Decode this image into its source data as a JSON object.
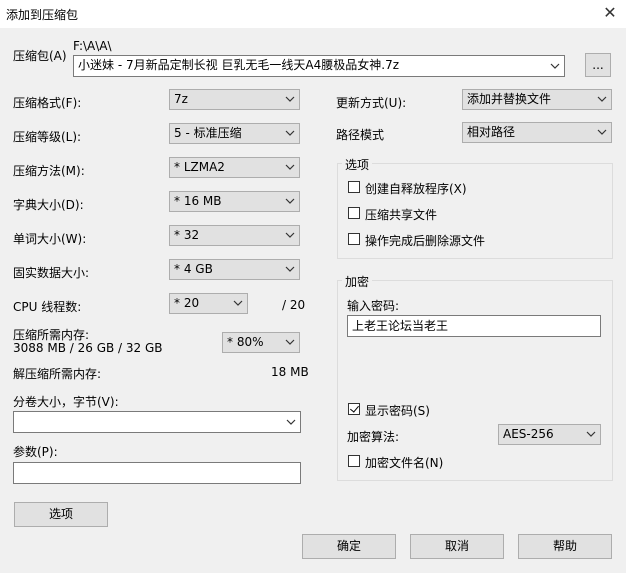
{
  "window": {
    "title": "添加到压缩包",
    "close_glyph": "✕"
  },
  "archive": {
    "label": "压缩包(A)",
    "path": "F:\\A\\A\\",
    "filename": "小迷妹 - 7月新品定制长视 巨乳无毛一线天A4腰极品女神.7z",
    "browse_label": "..."
  },
  "left": {
    "format": {
      "label": "压缩格式(F):",
      "value": "7z"
    },
    "level": {
      "label": "压缩等级(L):",
      "value": "5 - 标准压缩"
    },
    "method": {
      "label": "压缩方法(M):",
      "value": "* LZMA2"
    },
    "dict": {
      "label": "字典大小(D):",
      "value": "* 16 MB"
    },
    "word": {
      "label": "单词大小(W):",
      "value": "* 32"
    },
    "solid": {
      "label": "固实数据大小:",
      "value": "* 4 GB"
    },
    "threads": {
      "label": "CPU 线程数:",
      "value": "* 20",
      "max": "/ 20"
    },
    "mem_comp": {
      "label": "压缩所需内存:",
      "detail": "3088 MB / 26 GB / 32 GB",
      "value": "* 80%"
    },
    "mem_decomp": {
      "label": "解压缩所需内存:",
      "value": "18 MB"
    },
    "volume": {
      "label": "分卷大小，字节(V):",
      "value": ""
    },
    "params": {
      "label": "参数(P):",
      "value": ""
    },
    "options_button": "选项"
  },
  "right": {
    "update": {
      "label": "更新方式(U):",
      "value": "添加并替换文件"
    },
    "path_mode": {
      "label": "路径模式",
      "value": "相对路径"
    },
    "options": {
      "title": "选项",
      "sfx": "创建自释放程序(X)",
      "shared": "压缩共享文件",
      "delete": "操作完成后删除源文件"
    },
    "encryption": {
      "title": "加密",
      "pw_label": "输入密码:",
      "pw_value": "上老王论坛当老王",
      "show_pw": "显示密码(S)",
      "method_label": "加密算法:",
      "method_value": "AES-256",
      "encrypt_names": "加密文件名(N)"
    }
  },
  "buttons": {
    "ok": "确定",
    "cancel": "取消",
    "help": "帮助"
  }
}
